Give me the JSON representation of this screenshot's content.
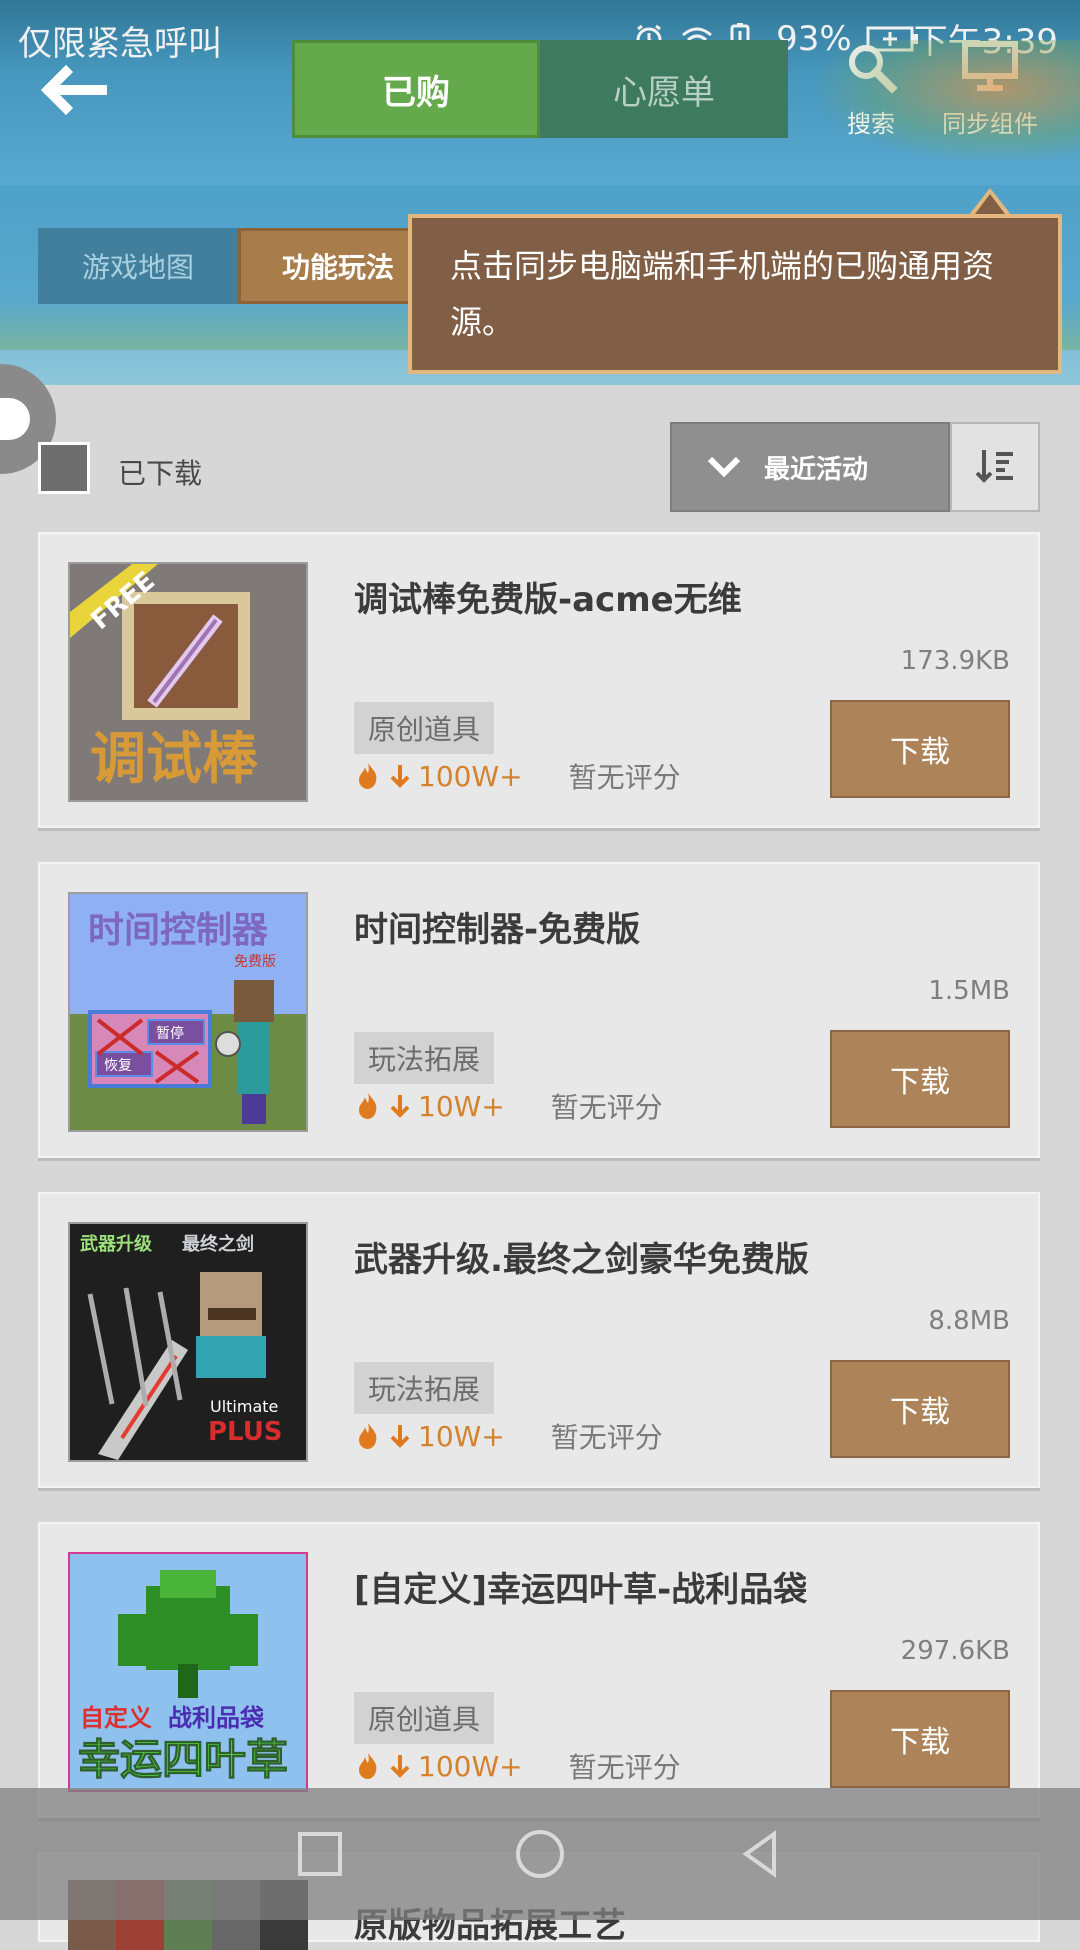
{
  "status_bar": {
    "left_text": "仅限紧急呼叫",
    "battery": "93%",
    "time": "下午3:39"
  },
  "header": {
    "tabs": [
      {
        "label": "已购",
        "active": true
      },
      {
        "label": "心愿单",
        "active": false
      }
    ],
    "actions": {
      "search": "搜索",
      "sync": "同步组件"
    },
    "sub_tabs": [
      {
        "label": "游戏地图"
      },
      {
        "label": "功能玩法"
      }
    ],
    "tooltip": "点击同步电脑端和手机端的已购通用资源。"
  },
  "filters": {
    "downloaded_label": "已下载",
    "sort_label": "最近活动"
  },
  "cards": [
    {
      "title": "调试棒免费版-acme无维",
      "size": "173.9KB",
      "tag": "原创道具",
      "downloads": "100W+",
      "rating": "暂无评分",
      "button": "下载",
      "image_text": [
        "FREE",
        "调试棒"
      ]
    },
    {
      "title": "时间控制器-免费版",
      "size": "1.5MB",
      "tag": "玩法拓展",
      "downloads": "10W+",
      "rating": "暂无评分",
      "button": "下载",
      "image_text": [
        "时间控制器",
        "免费版",
        "暂停",
        "恢复"
      ]
    },
    {
      "title": "武器升级.最终之剑豪华免费版",
      "size": "8.8MB",
      "tag": "玩法拓展",
      "downloads": "10W+",
      "rating": "暂无评分",
      "button": "下载",
      "image_text": [
        "武器升级",
        "最终之剑",
        "Ultimate",
        "PLUS"
      ]
    },
    {
      "title": "[自定义]幸运四叶草-战利品袋",
      "size": "297.6KB",
      "tag": "原创道具",
      "downloads": "100W+",
      "rating": "暂无评分",
      "button": "下载",
      "image_text": [
        "自定义",
        "战利品袋",
        "幸运四叶草"
      ]
    }
  ],
  "partial_card": {
    "title": "原版物品拓展工艺"
  },
  "colors": {
    "tab_active": "#64a94b",
    "tooltip_bg": "#805f46",
    "download_button": "#ad845a",
    "downloads_orange": "#d4822d"
  }
}
